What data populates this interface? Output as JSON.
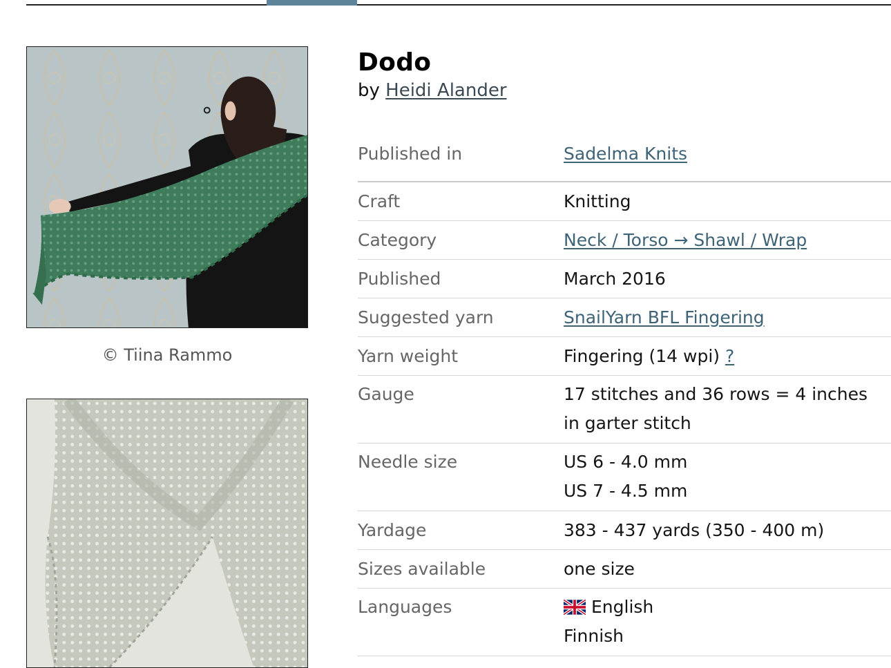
{
  "pattern": {
    "title": "Dodo",
    "by_prefix": "by",
    "designer": "Heidi Alander"
  },
  "photos": {
    "credit": "© Tiina Rammo"
  },
  "details": {
    "published_in_label": "Published in",
    "published_in_value": "Sadelma Knits",
    "craft_label": "Craft",
    "craft_value": "Knitting",
    "category_label": "Category",
    "category_value": "Neck / Torso → Shawl / Wrap",
    "published_label": "Published",
    "published_value": "March 2016",
    "suggested_yarn_label": "Suggested yarn",
    "suggested_yarn_value": "SnailYarn BFL Fingering",
    "yarn_weight_label": "Yarn weight",
    "yarn_weight_value": "Fingering (14 wpi)",
    "yarn_weight_help": "?",
    "gauge_label": "Gauge",
    "gauge_line1": "17 stitches and 36 rows = 4 inches",
    "gauge_line2": "in garter stitch",
    "needle_label": "Needle size",
    "needles": [
      "US 6 - 4.0 mm",
      "US 7 - 4.5 mm"
    ],
    "yardage_label": "Yardage",
    "yardage_value": "383 - 437 yards (350 - 400 m)",
    "sizes_label": "Sizes available",
    "sizes_value": "one size",
    "languages_label": "Languages",
    "languages": [
      "English",
      "Finnish"
    ]
  },
  "colors": {
    "link": "#3e6376",
    "tab_indicator": "#5d8499",
    "shawl_green": "#3f7d5c",
    "shawl_grey": "#c9cdc2"
  }
}
